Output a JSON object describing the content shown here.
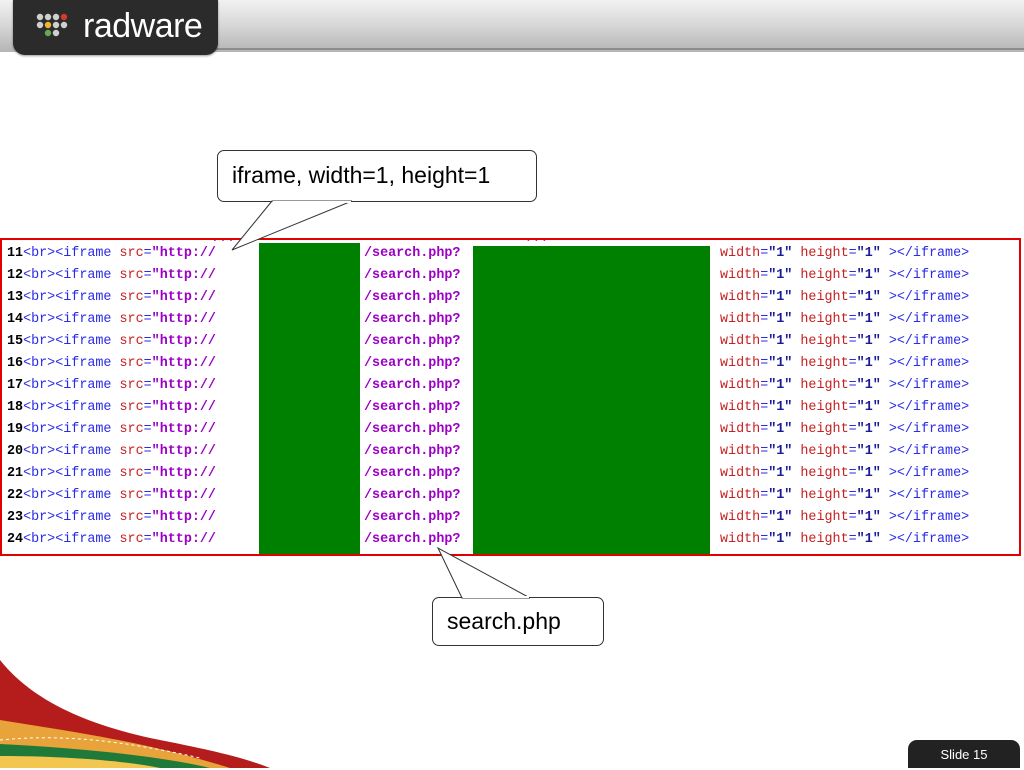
{
  "header": {
    "logo_text": "radware"
  },
  "code_panel": {
    "lines": [
      {
        "num": "11"
      },
      {
        "num": "12"
      },
      {
        "num": "13"
      },
      {
        "num": "14"
      },
      {
        "num": "15"
      },
      {
        "num": "16"
      },
      {
        "num": "17"
      },
      {
        "num": "18"
      },
      {
        "num": "19"
      },
      {
        "num": "20"
      },
      {
        "num": "21"
      },
      {
        "num": "22"
      },
      {
        "num": "23"
      },
      {
        "num": "24"
      }
    ],
    "fragments": {
      "br_iframe_open": "<br><iframe ",
      "src_attr": "src",
      "equals": "=",
      "url_prefix": "\"http://",
      "path": "/search.php?",
      "width_attr": "width",
      "width_val": "\"1\"",
      "height_attr": "height",
      "height_val": "\"1\"",
      "close_tag": "></iframe>"
    },
    "redaction_color": "#008000",
    "border_color": "#e00000"
  },
  "callouts": {
    "iframe_label": "iframe, width=1, height=1",
    "search_label": "search.php"
  },
  "footer": {
    "slide_label": "Slide 15"
  }
}
